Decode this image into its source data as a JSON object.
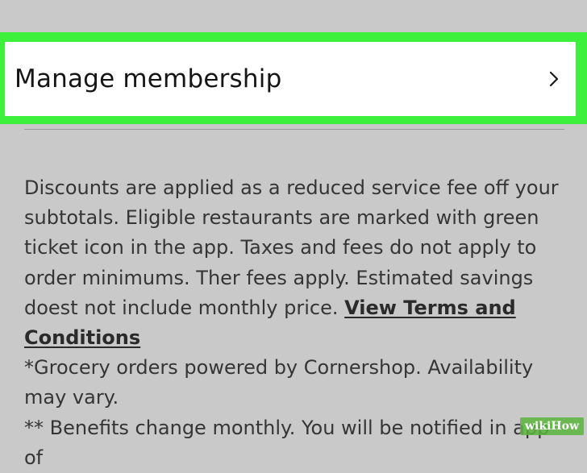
{
  "membership": {
    "manage_label": "Manage membership",
    "chevron_icon": "chevron-right-icon",
    "highlight_color": "#3cf03c"
  },
  "info": {
    "paragraph_main": "Discounts are applied as a reduced service fee off your subtotals. Eligible restaurants are marked with green ticket icon in the app. Taxes and fees do not apply to order minimums. Ther fees apply. Estimated savings doest not include monthly price. ",
    "terms_link": "View Terms and Conditions",
    "grocery_note": "*Grocery orders powered by Cornershop. Availability may vary.",
    "benefits_note": "** Benefits change monthly. You will be notified in app of"
  },
  "watermark": {
    "text": "wikiHow"
  }
}
